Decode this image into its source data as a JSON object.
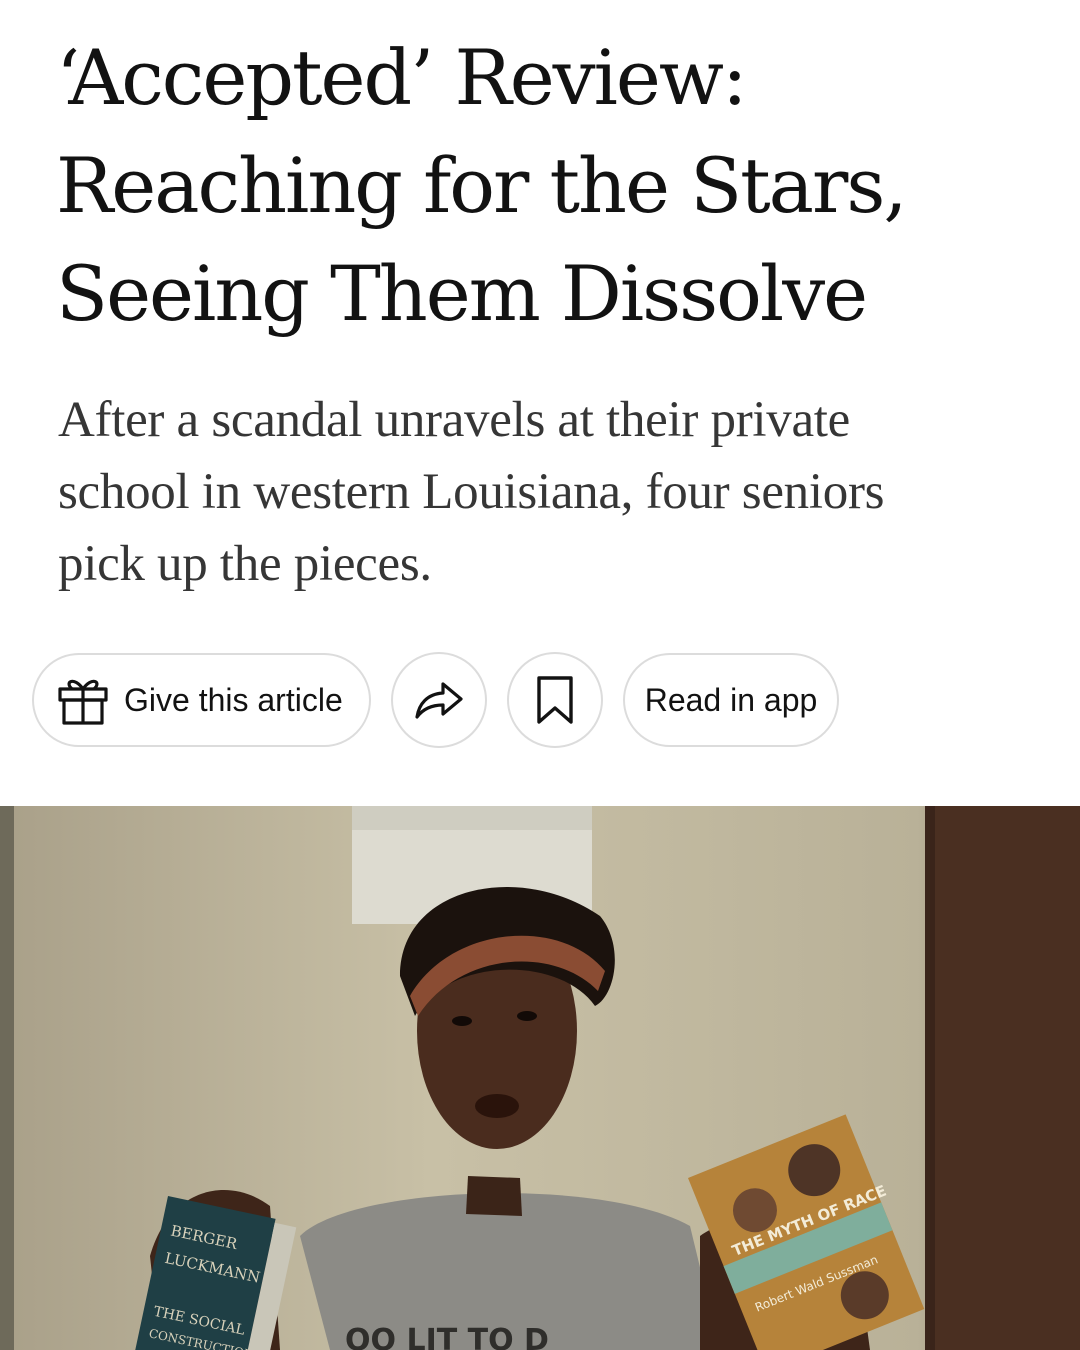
{
  "article": {
    "headline_lines": [
      "‘Accepted’ Review:",
      "Reaching for the Stars,",
      "Seeing Them Dissolve"
    ],
    "dek_lines": [
      "After a scandal unravels at their private",
      "school in western Louisiana, four seniors",
      "pick up the pieces."
    ]
  },
  "actions": {
    "gift_label": "Give this article",
    "read_in_app_label": "Read in app",
    "icons": [
      "gift-icon",
      "share-icon",
      "bookmark-icon"
    ]
  },
  "photo": {
    "book_left_lines": [
      "BERGER",
      "LUCKMANN",
      "THE SOCIAL",
      "CONSTRUCTION"
    ],
    "book_right_title": "THE MYTH OF RACE",
    "book_right_author": "Robert Wald Sussman",
    "shirt_text": "OO LIT TO D"
  },
  "colors": {
    "headline": "#121212",
    "dek": "#363636",
    "pill_border": "#dcdcdc"
  }
}
